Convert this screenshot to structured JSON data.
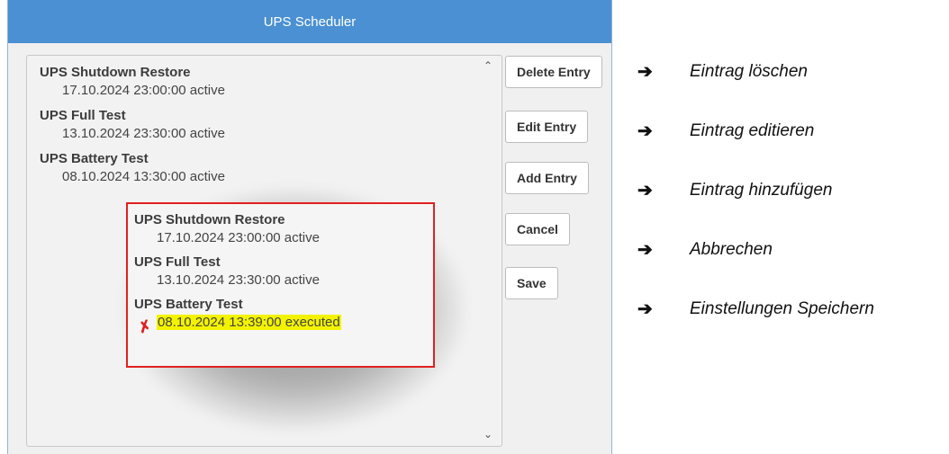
{
  "window": {
    "title": "UPS Scheduler"
  },
  "list": {
    "entries": [
      {
        "title": "UPS Shutdown Restore",
        "detail": "17.10.2024 23:00:00 active"
      },
      {
        "title": "UPS Full Test",
        "detail": "13.10.2024 23:30:00 active"
      },
      {
        "title": "UPS Battery Test",
        "detail": "08.10.2024 13:30:00 active"
      }
    ]
  },
  "callout": {
    "entries": [
      {
        "title": "UPS Shutdown Restore",
        "detail": "17.10.2024 23:00:00 active"
      },
      {
        "title": "UPS Full Test",
        "detail": "13.10.2024 23:30:00 active"
      },
      {
        "title": "UPS Battery Test",
        "detail": "08.10.2024 13:39:00 executed"
      }
    ],
    "border_color": "#e02020",
    "highlight_color": "#f3f300"
  },
  "buttons": {
    "delete": "Delete Entry",
    "edit": "Edit Entry",
    "add": "Add Entry",
    "cancel": "Cancel",
    "save": "Save"
  },
  "annotations": [
    {
      "arrow": "➔",
      "text": "Eintrag löschen"
    },
    {
      "arrow": "➔",
      "text": "Eintrag editieren"
    },
    {
      "arrow": "➔",
      "text": "Eintrag hinzufügen"
    },
    {
      "arrow": "➔",
      "text": "Abbrechen"
    },
    {
      "arrow": "➔",
      "text": "Einstellungen Speichern"
    }
  ],
  "colors": {
    "titlebar": "#4a90d2",
    "dialog_bg": "#f0f0f0"
  }
}
